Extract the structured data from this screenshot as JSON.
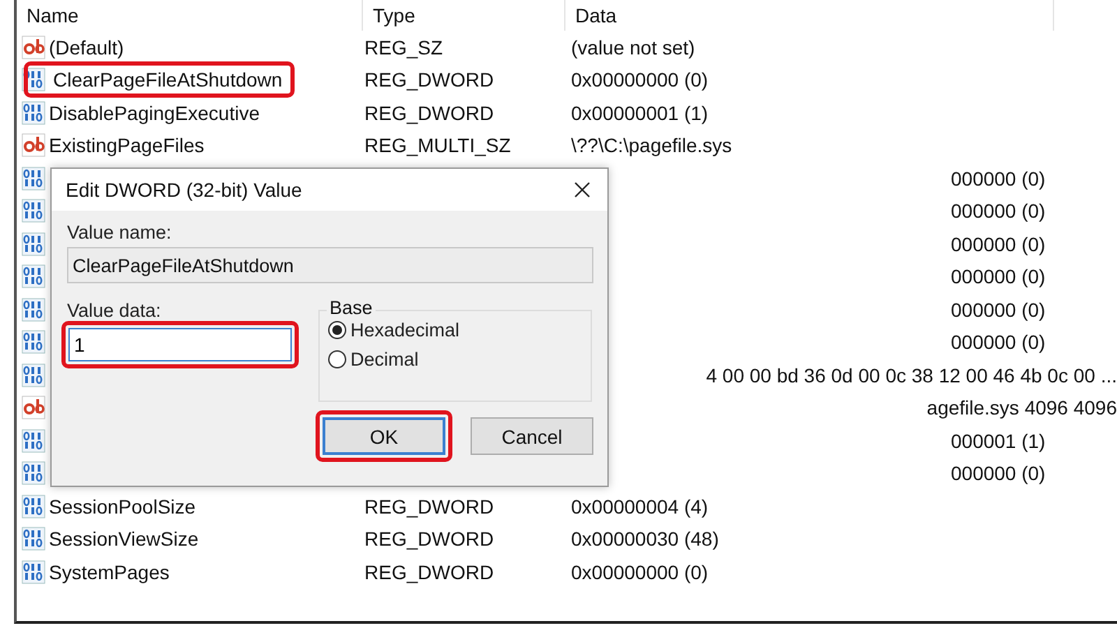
{
  "table": {
    "columns": [
      "Name",
      "Type",
      "Data"
    ],
    "rows": [
      {
        "kind": "string",
        "name": "(Default)",
        "type": "REG_SZ",
        "data": "(value not set)",
        "highlighted": false
      },
      {
        "kind": "binary",
        "name": "ClearPageFileAtShutdown",
        "type": "REG_DWORD",
        "data": "0x00000000 (0)",
        "highlighted": true
      },
      {
        "kind": "binary",
        "name": "DisablePagingExecutive",
        "type": "REG_DWORD",
        "data": "0x00000001 (1)",
        "highlighted": false
      },
      {
        "kind": "string",
        "name": "ExistingPageFiles",
        "type": "REG_MULTI_SZ",
        "data": "\\??\\C:\\pagefile.sys",
        "highlighted": false
      },
      {
        "kind": "binary",
        "data": "000000 (0)"
      },
      {
        "kind": "binary",
        "data": "000000 (0)"
      },
      {
        "kind": "binary",
        "data": "000000 (0)"
      },
      {
        "kind": "binary",
        "data": "000000 (0)"
      },
      {
        "kind": "binary",
        "data": "000000 (0)"
      },
      {
        "kind": "binary",
        "data": "000000 (0)"
      },
      {
        "kind": "binary",
        "data": "4 00 00 bd 36 0d 00 0c 38 12 00 46 4b 0c 00 ..."
      },
      {
        "kind": "string",
        "data": "agefile.sys 4096 4096"
      },
      {
        "kind": "binary",
        "data": "000001 (1)"
      },
      {
        "kind": "binary",
        "data": "000000 (0)"
      },
      {
        "kind": "binary",
        "name": "SessionPoolSize",
        "type": "REG_DWORD",
        "data": "0x00000004 (4)",
        "highlighted": false
      },
      {
        "kind": "binary",
        "name": "SessionViewSize",
        "type": "REG_DWORD",
        "data": "0x00000030 (48)",
        "highlighted": false
      },
      {
        "kind": "binary",
        "name": "SystemPages",
        "type": "REG_DWORD",
        "data": "0x00000000 (0)",
        "highlighted": false
      }
    ]
  },
  "dialog": {
    "title": "Edit DWORD (32-bit) Value",
    "value_name_label": "Value name:",
    "value_name": "ClearPageFileAtShutdown",
    "value_data_label": "Value data:",
    "value_data": "1",
    "value_data_highlighted": true,
    "base": {
      "label": "Base",
      "options": [
        {
          "label": "Hexadecimal",
          "selected": true
        },
        {
          "label": "Decimal",
          "selected": false
        }
      ]
    },
    "buttons": [
      {
        "label": "OK",
        "default": true,
        "highlighted": true
      },
      {
        "label": "Cancel",
        "default": false,
        "highlighted": false
      }
    ]
  }
}
